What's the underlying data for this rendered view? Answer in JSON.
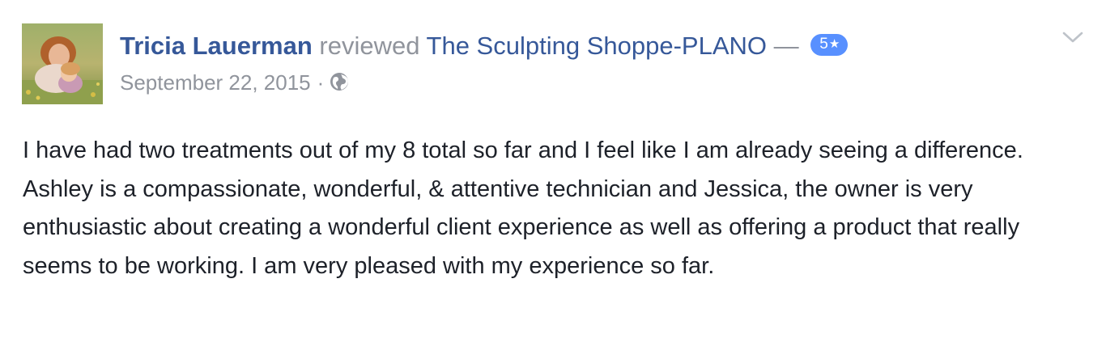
{
  "review": {
    "author_name": "Tricia Lauerman",
    "action_text": "reviewed",
    "page_name": "The Sculpting Shoppe-PLANO",
    "dash": "—",
    "rating_label": "5",
    "rating_star": "★",
    "rating_value": 5,
    "date": "September 22, 2015",
    "separator": "·",
    "privacy_icon": "globe-icon",
    "options_icon": "chevron-down-icon",
    "body": "I have had two treatments out of my 8 total so far and I feel like I am already seeing a difference. Ashley is a compassionate, wonderful, & attentive technician and Jessica, the owner is very enthusiastic about creating a wonderful client experience as well as offering a product that really seems to be working. I am very pleased with my experience so far."
  },
  "colors": {
    "link": "#365899",
    "muted": "#90949c",
    "badge": "#5890ff",
    "text": "#1d2129"
  }
}
